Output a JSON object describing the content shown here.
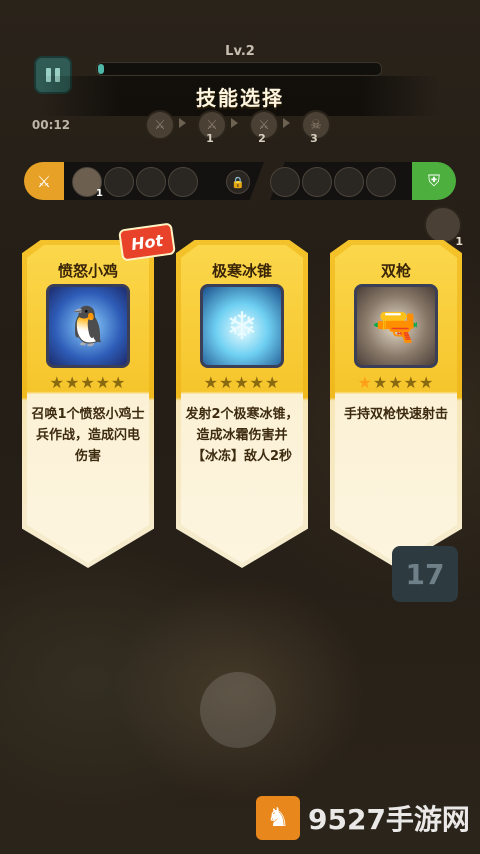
{
  "hud": {
    "level": "Lv.2",
    "xp_progress": 0.02,
    "timer": "00:12"
  },
  "title": "技能选择",
  "steps": [
    {
      "number": "1",
      "icon": "sword-icon"
    },
    {
      "number": "2",
      "icon": "sword-icon"
    },
    {
      "number": "3",
      "icon": "skull-icon"
    }
  ],
  "slots": {
    "attack_icon": "sword-icon",
    "defense_icon": "shield-icon",
    "attack_slot_level": "1",
    "side_avatar_level": "1"
  },
  "hot_badge": "Hot",
  "cards": [
    {
      "name": "愤怒小鸡",
      "icon": "angry-chicken-icon",
      "stars": 0,
      "description": "召唤1个愤怒小鸡士兵作战，造成闪电伤害"
    },
    {
      "name": "极寒冰锥",
      "icon": "ice-shard-icon",
      "stars": 0,
      "description": "发射2个极寒冰锥，造成冰霜伤害并【冰冻】敌人2秒"
    },
    {
      "name": "双枪",
      "icon": "dual-pistols-icon",
      "stars": 1,
      "description": "手持双枪快速射击"
    }
  ],
  "counter": "17",
  "watermark": {
    "text": "9527手游网"
  },
  "colors": {
    "card_gold": "#f4c22a",
    "attack": "#e6a126",
    "defense": "#4caf3e",
    "hot": "#e8422a"
  }
}
